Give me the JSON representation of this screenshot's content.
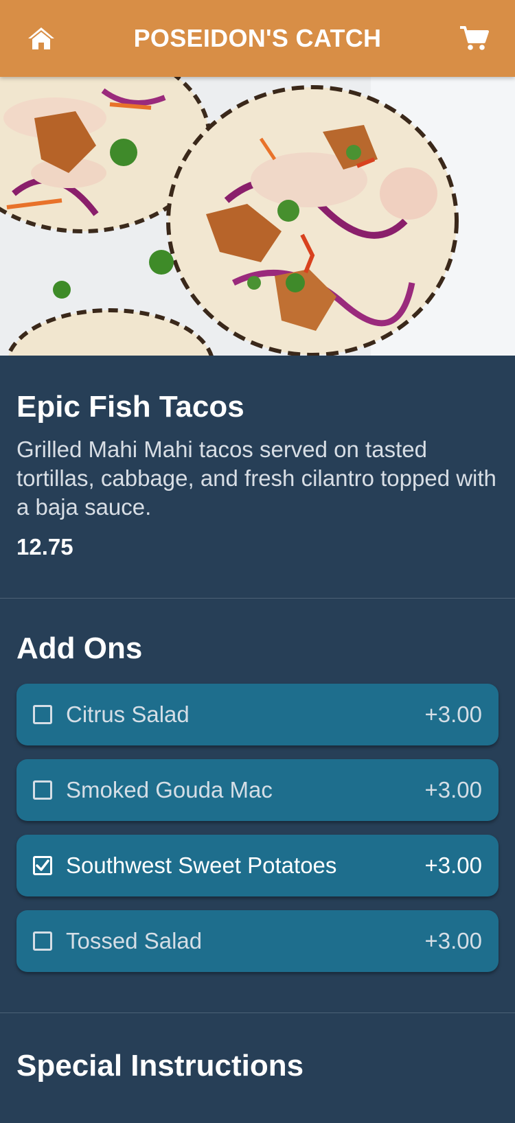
{
  "header": {
    "title": "POSEIDON'S CATCH",
    "home_icon": "home-icon",
    "cart_icon": "cart-icon",
    "background": "#d88e46"
  },
  "item": {
    "name": "Epic Fish Tacos",
    "description": "Grilled Mahi Mahi tacos served on tasted tortillas, cabbage, and fresh cilantro topped with a baja sauce.",
    "price": "12.75"
  },
  "addons": {
    "title": "Add Ons",
    "items": [
      {
        "label": "Citrus Salad",
        "price": "+3.00",
        "checked": false
      },
      {
        "label": "Smoked Gouda Mac",
        "price": "+3.00",
        "checked": false
      },
      {
        "label": "Southwest Sweet Potatoes",
        "price": "+3.00",
        "checked": true
      },
      {
        "label": "Tossed Salad",
        "price": "+3.00",
        "checked": false
      }
    ]
  },
  "special": {
    "title": "Special Instructions"
  },
  "colors": {
    "background": "#273f57",
    "addon_row": "#1e6e8d"
  }
}
